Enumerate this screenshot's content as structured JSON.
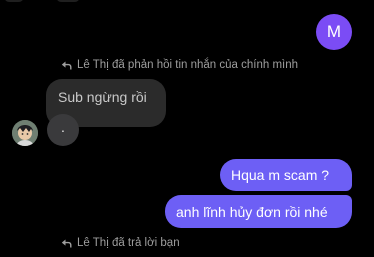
{
  "conversation": {
    "self_avatar_initial": "M",
    "reply_notice_1": "Lê Thị đã phản hồi tin nhắn của chính mình",
    "quoted_message": "Sub ngừng rồi",
    "incoming_message": ".",
    "outgoing_messages": [
      "Hqua m scam ?",
      "anh lĩnh hủy đơn rồi nhé"
    ],
    "reply_notice_2": "Lê Thị đã trả lời bạn"
  },
  "colors": {
    "background": "#000000",
    "outgoing_bubble": "#6d5ff5",
    "incoming_bubble": "#3a3a3c",
    "quoted_bubble": "#2b2b2b",
    "self_avatar": "#7b4cf5",
    "meta_text": "#9e9e9e"
  },
  "icons": {
    "reply": "reply-arrow-icon"
  }
}
